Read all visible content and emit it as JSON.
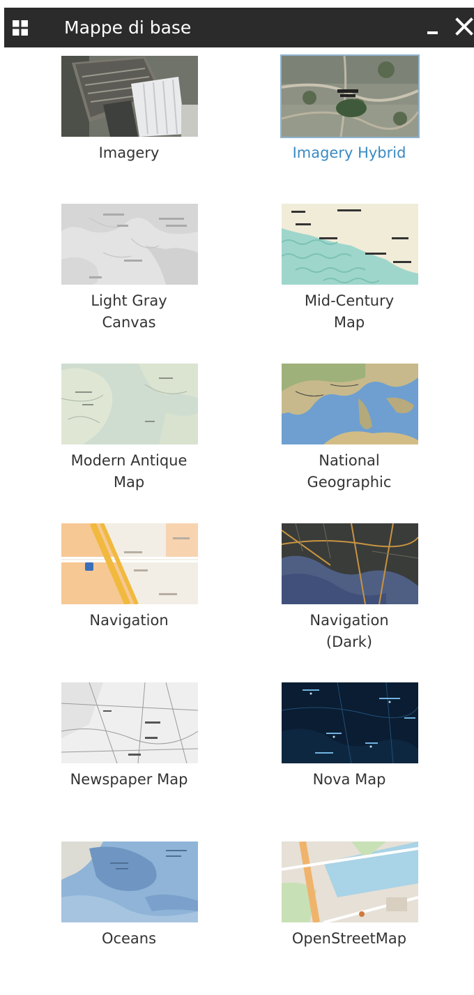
{
  "panel": {
    "title": "Mappe di base",
    "minimize_glyph": "–",
    "icons": [
      "grid-icon",
      "minimize-icon",
      "close-icon"
    ]
  },
  "basemaps": [
    {
      "label": "Imagery",
      "thumbnail": "imagery-thumbnail",
      "selected": false
    },
    {
      "label": "Imagery Hybrid",
      "thumbnail": "imagery-hybrid-thumbnail",
      "selected": true
    },
    {
      "label": "Light Gray\nCanvas",
      "thumbnail": "light-gray-canvas-thumbnail",
      "selected": false
    },
    {
      "label": "Mid-Century\nMap",
      "thumbnail": "mid-century-map-thumbnail",
      "selected": false
    },
    {
      "label": "Modern Antique\nMap",
      "thumbnail": "modern-antique-map-thumbnail",
      "selected": false
    },
    {
      "label": "National\nGeographic",
      "thumbnail": "national-geographic-thumbnail",
      "selected": false
    },
    {
      "label": "Navigation",
      "thumbnail": "navigation-thumbnail",
      "selected": false
    },
    {
      "label": "Navigation\n(Dark)",
      "thumbnail": "navigation-dark-thumbnail",
      "selected": false
    },
    {
      "label": "Newspaper Map",
      "thumbnail": "newspaper-map-thumbnail",
      "selected": false
    },
    {
      "label": "Nova Map",
      "thumbnail": "nova-map-thumbnail",
      "selected": false
    },
    {
      "label": "Oceans",
      "thumbnail": "oceans-thumbnail",
      "selected": false
    },
    {
      "label": "OpenStreetMap",
      "thumbnail": "openstreetmap-thumbnail",
      "selected": false
    }
  ],
  "colors": {
    "titlebar": "#2b2b2b",
    "title_text": "#ffffff",
    "label_text": "#333333",
    "selected_label": "#3a8ac2"
  }
}
